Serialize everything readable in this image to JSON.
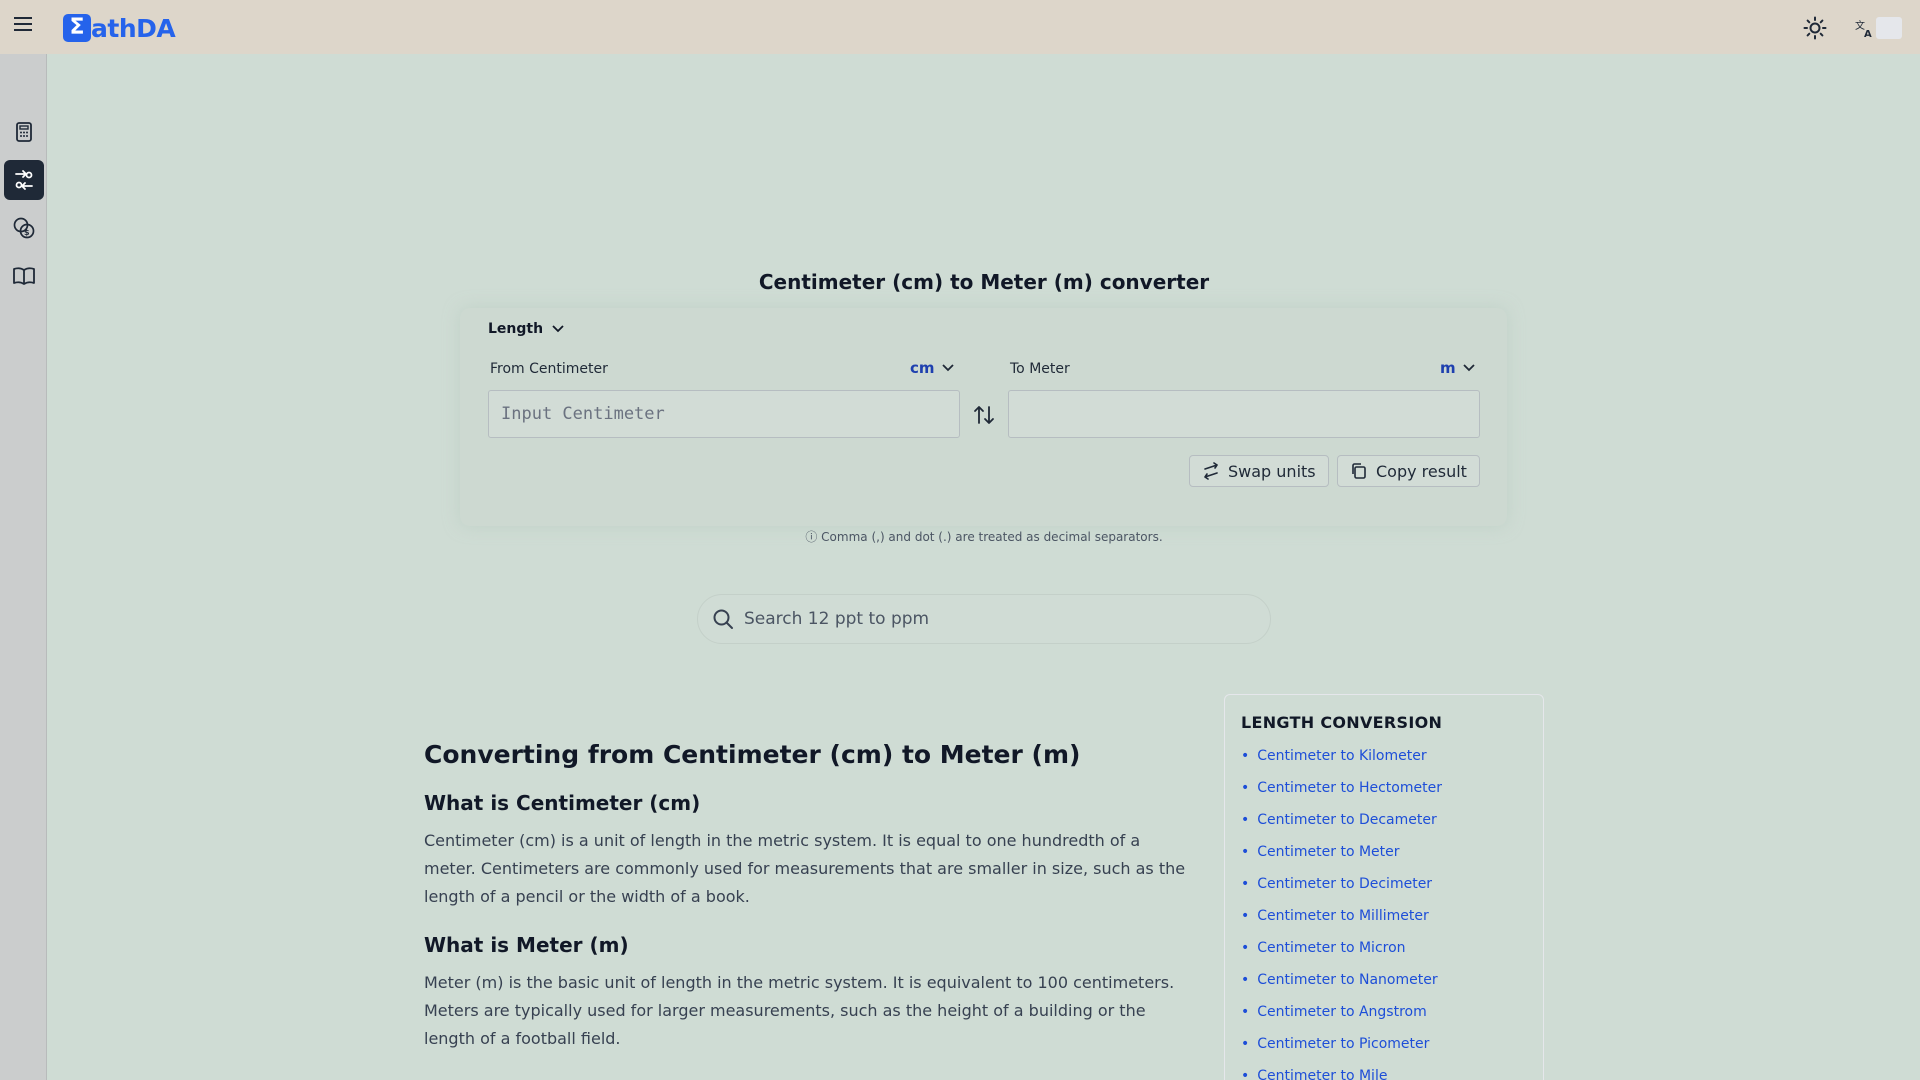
{
  "header": {
    "logo_mark": "Σ",
    "logo_text": "athDA"
  },
  "sidebar": {
    "items": [
      {
        "name": "calculator-icon",
        "active": false
      },
      {
        "name": "converter-icon",
        "active": true
      },
      {
        "name": "currency-icon",
        "active": false
      },
      {
        "name": "book-icon",
        "active": false
      }
    ]
  },
  "converter": {
    "title": "Centimeter (cm) to Meter (m) converter",
    "category": "Length",
    "from_label": "From Centimeter",
    "from_unit": "cm",
    "to_label": "To Meter",
    "to_unit": "m",
    "input_placeholder": "Input Centimeter",
    "output_value": "",
    "swap_label": "Swap units",
    "copy_label": "Copy result",
    "note": "ⓘ Comma (,) and dot (.) are treated as decimal separators."
  },
  "search": {
    "placeholder": "Search 12 ppt to ppm"
  },
  "article": {
    "heading": "Converting from Centimeter (cm) to Meter (m)",
    "sections": [
      {
        "title": "What is Centimeter (cm)",
        "body": "Centimeter (cm) is a unit of length in the metric system. It is equal to one hundredth of a meter. Centimeters are commonly used for measurements that are smaller in size, such as the length of a pencil or the width of a book."
      },
      {
        "title": "What is Meter (m)",
        "body": "Meter (m) is the basic unit of length in the metric system. It is equivalent to 100 centimeters. Meters are typically used for larger measurements, such as the height of a building or the length of a football field."
      }
    ]
  },
  "related": {
    "title": "LENGTH CONVERSION",
    "links": [
      "Centimeter to Kilometer",
      "Centimeter to Hectometer",
      "Centimeter to Decameter",
      "Centimeter to Meter",
      "Centimeter to Decimeter",
      "Centimeter to Millimeter",
      "Centimeter to Micron",
      "Centimeter to Nanometer",
      "Centimeter to Angstrom",
      "Centimeter to Picometer",
      "Centimeter to Mile"
    ]
  },
  "colors": {
    "accent": "#2563eb",
    "link": "#1d4ed8",
    "background": "#cfdcd4",
    "header": "#ddd6ca"
  }
}
